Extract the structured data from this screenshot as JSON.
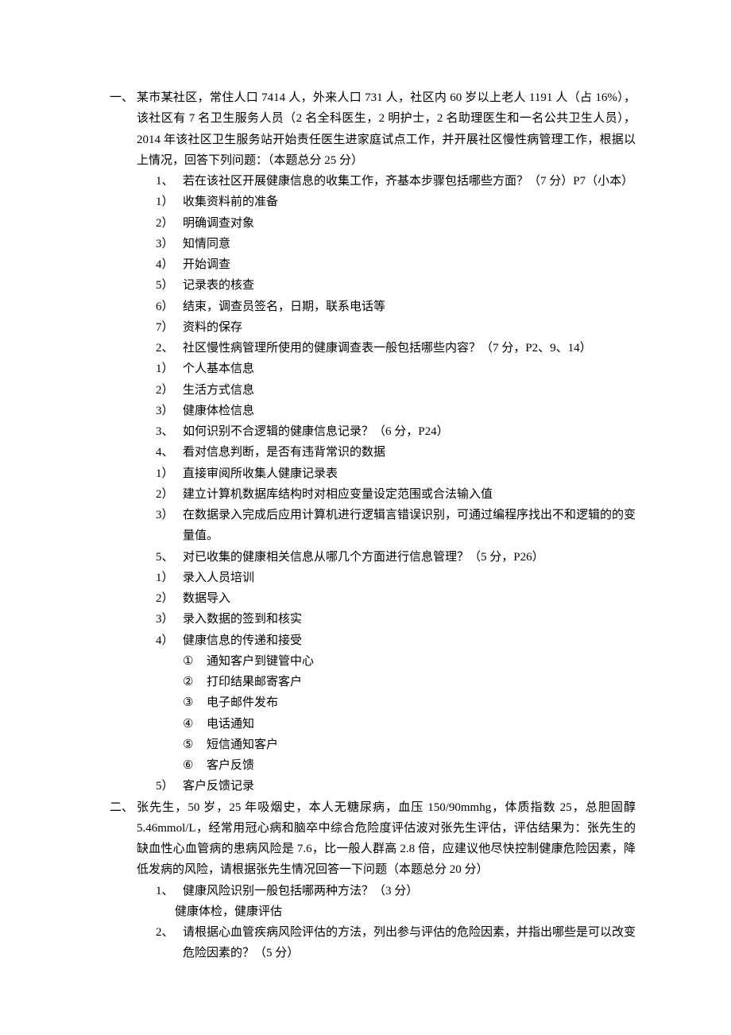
{
  "sections": [
    {
      "marker": "一、",
      "intro": "某市某社区，常住人口 7414 人，外来人口 731 人，社区内 60 岁以上老人 1191 人（占 16%），该社区有 7 名卫生服务人员（2 名全科医生，2 明护士，2 名助理医生和一名公共卫生人员），2014 年该社区卫生服务站开始责任医生进家庭试点工作，并开展社区慢性病管理工作，根据以上情况，回答下列问题：（本题总分 25 分）",
      "items": [
        {
          "type": "q",
          "marker": "1、",
          "text": "若在该社区开展健康信息的收集工作，齐基本步骤包括哪些方面？（7 分）P7（小本）"
        },
        {
          "type": "a",
          "marker": "1）",
          "text": "收集资料前的准备"
        },
        {
          "type": "a",
          "marker": "2）",
          "text": "明确调查对象"
        },
        {
          "type": "a",
          "marker": "3）",
          "text": "知情同意"
        },
        {
          "type": "a",
          "marker": "4）",
          "text": "开始调查"
        },
        {
          "type": "a",
          "marker": "5）",
          "text": "记录表的核查"
        },
        {
          "type": "a",
          "marker": "6）",
          "text": "结束，调查员签名，日期，联系电话等"
        },
        {
          "type": "a",
          "marker": "7）",
          "text": "资料的保存"
        },
        {
          "type": "q",
          "marker": "2、",
          "text": "社区慢性病管理所使用的健康调查表一般包括哪些内容？（7 分，P2、9、14）"
        },
        {
          "type": "a",
          "marker": "1）",
          "text": "个人基本信息"
        },
        {
          "type": "a",
          "marker": "2）",
          "text": "生活方式信息"
        },
        {
          "type": "a",
          "marker": "3）",
          "text": "健康体检信息"
        },
        {
          "type": "q",
          "marker": "3、",
          "text": "如何识别不合逻辑的健康信息记录？（6 分，P24）"
        },
        {
          "type": "q",
          "marker": "4、",
          "text": "看对信息判断，是否有违背常识的数据"
        },
        {
          "type": "a",
          "marker": "1）",
          "text": "直接审阅所收集人健康记录表"
        },
        {
          "type": "a",
          "marker": "2）",
          "text": "建立计算机数据库结构时对相应变量设定范围或合法输入值"
        },
        {
          "type": "a",
          "marker": "3）",
          "text": "在数据录入完成后应用计算机进行逻辑言错误识别，可通过编程序找出不和逻辑的的变量值。"
        },
        {
          "type": "q",
          "marker": "5、",
          "text": "对已收集的健康相关信息从哪几个方面进行信息管理？（5 分，P26）"
        },
        {
          "type": "a",
          "marker": "1）",
          "text": "录入人员培训"
        },
        {
          "type": "a",
          "marker": "2）",
          "text": "数据导入"
        },
        {
          "type": "a",
          "marker": "3）",
          "text": "录入数据的签到和核实"
        },
        {
          "type": "a",
          "marker": "4）",
          "text": "健康信息的传递和接受"
        },
        {
          "type": "sub",
          "marker": "①",
          "text": "通知客户到键管中心"
        },
        {
          "type": "sub",
          "marker": "②",
          "text": "打印结果邮寄客户"
        },
        {
          "type": "sub",
          "marker": "③",
          "text": "电子邮件发布"
        },
        {
          "type": "sub",
          "marker": "④",
          "text": "电话通知"
        },
        {
          "type": "sub",
          "marker": "⑤",
          "text": "短信通知客户"
        },
        {
          "type": "sub",
          "marker": "⑥",
          "text": "客户反馈"
        },
        {
          "type": "a",
          "marker": "5）",
          "text": "客户反馈记录"
        }
      ]
    },
    {
      "marker": "二、",
      "intro": "张先生，50 岁，25 年吸烟史，本人无糖尿病，血压 150/90mmhg，体质指数 25，总胆固醇 5.46mmol/L，经常用冠心病和脑卒中综合危险度评估波对张先生评估，评估结果为：张先生的缺血性心血管病的患病风险是 7.6，比一般人群高 2.8 倍，应建议他尽快控制健康危险因素，降低发病的风险，请根据张先生情况回答一下问题（本题总分 20 分）",
      "items": [
        {
          "type": "q",
          "marker": "1、",
          "text": "健康风险识别一般包括哪两种方法？（3 分）"
        },
        {
          "type": "plain",
          "text": "健康体检，健康评估"
        },
        {
          "type": "q",
          "marker": "2、",
          "text": "请根据心血管疾病风险评估的方法，列出参与评估的危险因素，并指出哪些是可以改变危险因素的？（5 分）"
        }
      ]
    }
  ]
}
